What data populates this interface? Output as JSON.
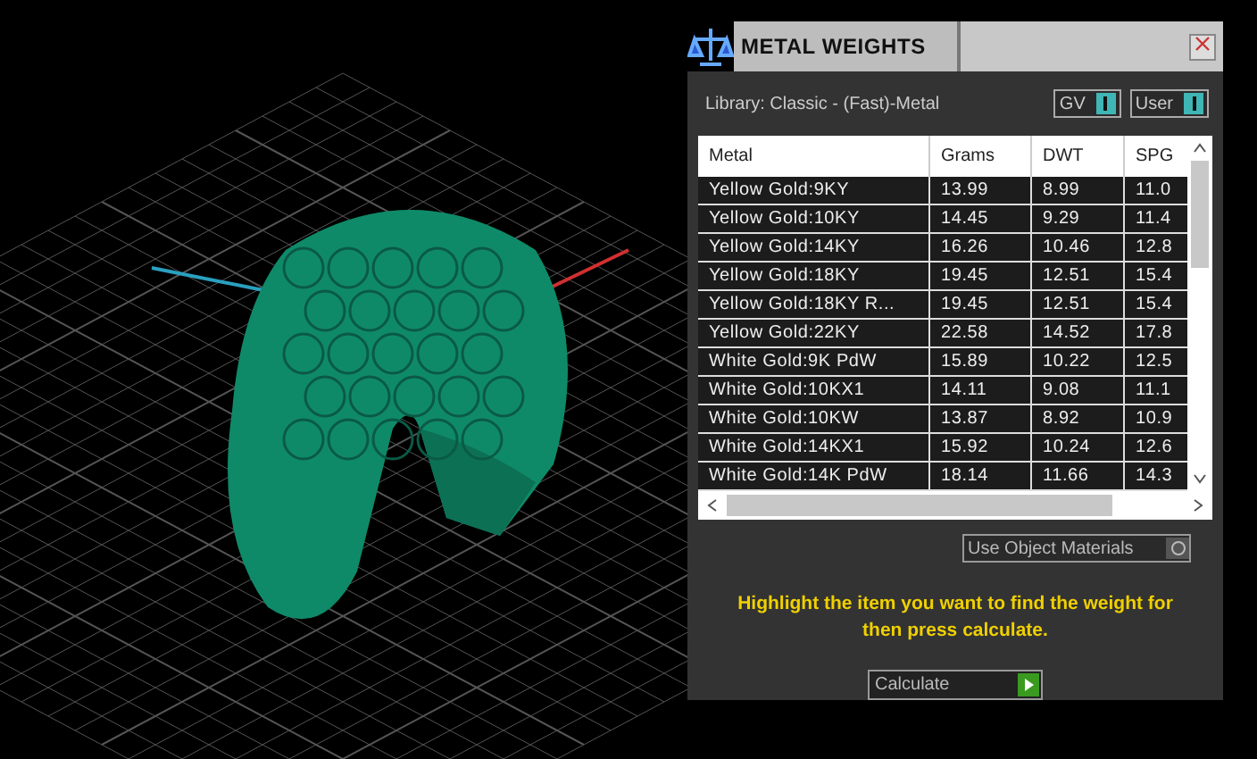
{
  "panel": {
    "title": "METAL WEIGHTS",
    "library": "Library: Classic - (Fast)-Metal",
    "toggles": [
      {
        "label": "GV",
        "on": true
      },
      {
        "label": "User",
        "on": true
      }
    ],
    "table": {
      "columns": [
        "Metal",
        "Grams",
        "DWT",
        "SPG"
      ],
      "rows": [
        [
          "Yellow Gold:9KY",
          "13.99",
          "8.99",
          "11.0"
        ],
        [
          "Yellow Gold:10KY",
          "14.45",
          "9.29",
          "11.4"
        ],
        [
          "Yellow Gold:14KY",
          "16.26",
          "10.46",
          "12.8"
        ],
        [
          "Yellow Gold:18KY",
          "19.45",
          "12.51",
          "15.4"
        ],
        [
          "Yellow Gold:18KY R...",
          "19.45",
          "12.51",
          "15.4"
        ],
        [
          "Yellow Gold:22KY",
          "22.58",
          "14.52",
          "17.8"
        ],
        [
          "White Gold:9K PdW",
          "15.89",
          "10.22",
          "12.5"
        ],
        [
          "White Gold:10KX1",
          "14.11",
          "9.08",
          "11.1"
        ],
        [
          "White Gold:10KW",
          "13.87",
          "8.92",
          "10.9"
        ],
        [
          "White Gold:14KX1",
          "15.92",
          "10.24",
          "12.6"
        ],
        [
          "White Gold:14K PdW",
          "18.14",
          "11.66",
          "14.3"
        ]
      ]
    },
    "use_object_materials": {
      "label": "Use Object Materials",
      "on": false
    },
    "instruction": "Highlight the item you want to find the weight for then press calculate.",
    "calculate_button": "Calculate"
  }
}
